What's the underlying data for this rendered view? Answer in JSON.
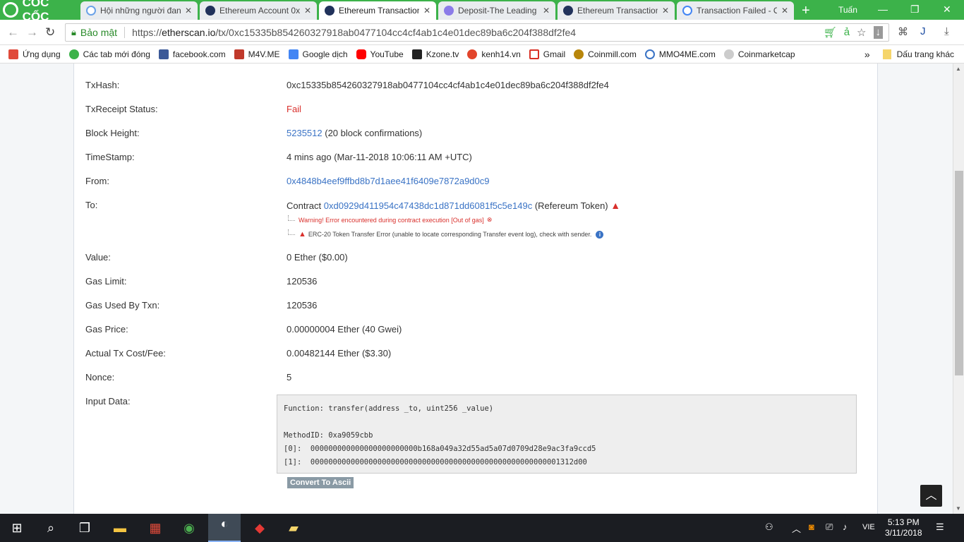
{
  "browser": {
    "brand": "CỐC CỐC",
    "tabs": [
      {
        "label": "Hội những người đan",
        "icon": "coccoc-s-icon"
      },
      {
        "label": "Ethereum Account 0x",
        "icon": "etherscan-icon"
      },
      {
        "label": "Ethereum Transaction",
        "icon": "etherscan-icon",
        "active": true
      },
      {
        "label": "Deposit-The Leading",
        "icon": "deposit-icon"
      },
      {
        "label": "Ethereum Transaction",
        "icon": "etherscan-icon"
      },
      {
        "label": "Transaction Failed - O",
        "icon": "google-icon"
      }
    ],
    "user": "Tuấn",
    "secure_label": "Bảo mật",
    "url_prefix": "https://",
    "url_host": "etherscan.io",
    "url_path": "/tx/0xc15335b854260327918ab0477104cc4cf4ab1c4e01dec89ba6c204f388df2fe4",
    "bookmarks": [
      {
        "label": "Ứng dụng",
        "color": "#e04a3a"
      },
      {
        "label": "Các tab mới đóng",
        "color": "#3cb24a"
      },
      {
        "label": "facebook.com",
        "color": "#3b5998"
      },
      {
        "label": "M4V.ME",
        "color": "#c0392b"
      },
      {
        "label": "Google dịch",
        "color": "#4285f4"
      },
      {
        "label": "YouTube",
        "color": "#ff0000"
      },
      {
        "label": "Kzone.tv",
        "color": "#222222"
      },
      {
        "label": "kenh14.vn",
        "color": "#e2452c"
      },
      {
        "label": "Gmail",
        "color": "#d93025"
      },
      {
        "label": "Coinmill.com",
        "color": "#b8860b"
      },
      {
        "label": "MMO4ME.com",
        "color": "#3a73c5"
      },
      {
        "label": "Coinmarketcap",
        "color": "#999999"
      }
    ],
    "bookmarks_more": "»",
    "other_bookmarks": "Dấu trang khác"
  },
  "tx": {
    "hash_label": "TxHash:",
    "hash": "0xc15335b854260327918ab0477104cc4cf4ab1c4e01dec89ba6c204f388df2fe4",
    "status_label": "TxReceipt Status:",
    "status": "Fail",
    "block_label": "Block Height:",
    "block": "5235512",
    "block_conf": "(20 block confirmations)",
    "time_label": "TimeStamp:",
    "time": "4 mins ago (Mar-11-2018 10:06:11 AM +UTC)",
    "from_label": "From:",
    "from": "0x4848b4eef9ffbd8b7d1aee41f6409e7872a9d0c9",
    "to_label": "To:",
    "to_prefix": "Contract",
    "to": "0xd0929d411954c47438dc1d871dd6081f5c5e149c",
    "to_name": "(Refereum Token)",
    "warning1": "Warning! Error encountered during contract execution [Out of gas]",
    "warning2": "ERC-20 Token Transfer Error (unable to locate corresponding Transfer event log), check with sender.",
    "value_label": "Value:",
    "value": "0 Ether ($0.00)",
    "gaslimit_label": "Gas Limit:",
    "gaslimit": "120536",
    "gasused_label": "Gas Used By Txn:",
    "gasused": "120536",
    "gasprice_label": "Gas Price:",
    "gasprice": "0.00000004 Ether (40 Gwei)",
    "fee_label": "Actual Tx Cost/Fee:",
    "fee": "0.00482144 Ether ($3.30)",
    "nonce_label": "Nonce:",
    "nonce": "5",
    "input_label": "Input Data:",
    "input_data": "Function: transfer(address _to, uint256 _value)\n\nMethodID: 0xa9059cbb\n[0]:  000000000000000000000000b168a049a32d55ad5a07d0709d28e9ac3fa9ccd5\n[1]:  00000000000000000000000000000000000000000000000000000001312d00",
    "convert_button": "Convert To Ascii"
  },
  "taskbar": {
    "lang": "VIE",
    "time": "5:13 PM",
    "date": "3/11/2018"
  }
}
